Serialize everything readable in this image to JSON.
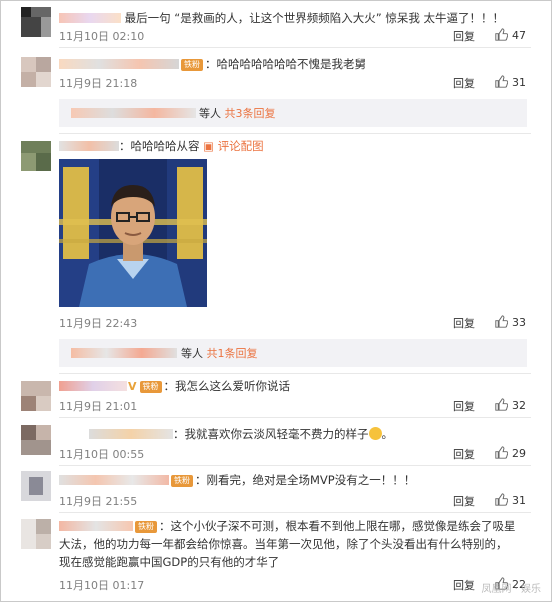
{
  "comments": [
    {
      "text": "最后一句 “是救画的人，让这个世界频频陷入大火” 惊呆我 太牛逼了！！！",
      "time": "11月10日 02:10",
      "reply": "回复",
      "likes": "47"
    },
    {
      "text": "哈哈哈哈哈哈哈不愧是我老舅",
      "time": "11月9日 21:18",
      "reply": "回复",
      "likes": "31",
      "sub": {
        "text": "等人",
        "link": "共3条回复"
      }
    },
    {
      "text": "哈哈哈哈从容",
      "link": "评论配图",
      "time": "11月9日 22:43",
      "reply": "回复",
      "likes": "33",
      "sub": {
        "text": "等人",
        "link": "共1条回复"
      }
    },
    {
      "text": "我怎么这么爱听你说话",
      "time": "11月9日 21:01",
      "reply": "回复",
      "likes": "32"
    },
    {
      "text": "我就喜欢你云淡风轻毫不费力的样子",
      "time": "11月10日 00:55",
      "reply": "回复",
      "likes": "29"
    },
    {
      "text": "刚看完，绝对是全场MVP没有之一！！！",
      "time": "11月9日 21:55",
      "reply": "回复",
      "likes": "31"
    },
    {
      "text_line1": "这个小伙子深不可测，根本看不到他上限在哪，感觉像是练会了吸星",
      "text_line2": "大法，他的功力每一年都会给你惊喜。当年第一次见他，除了个头没看出有什么特别的，",
      "text_line3": "现在感觉能跑赢中国GDP的只有他的才华了",
      "time": "11月10日 01:17",
      "reply": "回复",
      "likes": "22"
    }
  ],
  "badge_label": "铁粉",
  "watermark": "凤凰网 · 娱乐",
  "colors": {
    "link": "#eb7340",
    "badge": "#e8983a",
    "time": "#808080",
    "subbox": "#f2f2f5"
  }
}
